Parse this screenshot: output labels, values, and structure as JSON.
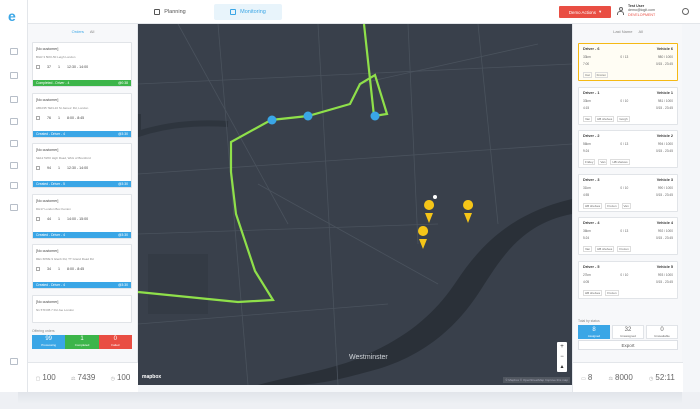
{
  "topbar": {
    "tabs": [
      {
        "label": "Planning"
      },
      {
        "label": "Monitoring"
      }
    ],
    "actions_label": "Demo Actions",
    "user": {
      "name": "Test User",
      "email": "demo@logit.com",
      "env": "DEVELOPMENT"
    }
  },
  "left": {
    "tabs": [
      "Orders",
      "All"
    ],
    "orders": [
      {
        "title": "[No customer]",
        "addr": "BGR 3 5RO-50 Leigh London",
        "qty": "37",
        "stops": "1",
        "time": "12:30 - 14:00",
        "status": "Completed - Driver - 4",
        "code": "@0:38",
        "color": "#3cb54a"
      },
      {
        "title": "[No customer]",
        "addr": "AB1035 7EFL10 St James' Rd, London",
        "qty": "76",
        "stops": "1",
        "time": "8:00 - 8:45",
        "status": "Created - Driver - 4",
        "code": "@3:30",
        "color": "#3aa6e6"
      },
      {
        "title": "[No customer]",
        "addr": "SE12 5WO High Road, Wick of Brentford",
        "qty": "94",
        "stops": "1",
        "time": "12:30 - 14:00",
        "status": "Created - Driver - 5",
        "code": "@3:30",
        "color": "#3aa6e6"
      },
      {
        "title": "[No customer]",
        "addr": "DH17 London Box Kenton",
        "qty": "44",
        "stops": "1",
        "time": "14:00 - 15:00",
        "status": "Created - Driver - 4",
        "code": "@3:30",
        "color": "#3aa6e6"
      },
      {
        "title": "[No customer]",
        "addr": "RE1 6PRE 9 Glenb Rd, TT Grand Road Rd",
        "qty": "34",
        "stops": "1",
        "time": "8:00 - 8:45",
        "status": "Created - Driver - 4",
        "code": "@3:30",
        "color": "#3aa6e6"
      },
      {
        "title": "[No customer]",
        "addr": "N1 5TFOB 7 Rd Joe London",
        "qty": "",
        "stops": "",
        "time": "",
        "status": "",
        "code": "",
        "color": "#3aa6e6"
      }
    ],
    "summary_label": "Offering orders",
    "summary": [
      {
        "value": "99",
        "label": "Processing",
        "color": "#3aa6e6"
      },
      {
        "value": "1",
        "label": "Completed",
        "color": "#3cb54a"
      },
      {
        "value": "0",
        "label": "Failed",
        "color": "#e94e43"
      }
    ],
    "stats": [
      "100",
      "7439",
      "100"
    ]
  },
  "map": {
    "labels": [
      {
        "text": "Westminster",
        "big": true
      },
      {
        "text": "mapbox",
        "big": false
      }
    ],
    "attribution": "© Mapbox © OpenStreetMap Improve this map",
    "zoom_in": "+",
    "zoom_out": "−"
  },
  "right": {
    "tabs": [
      "Last Name",
      "All"
    ],
    "vehicles": [
      {
        "driver": "Driver - 6",
        "vehicle": "Vehicle 6",
        "r1": [
          "33km",
          "0 / 13",
          "980 / 1000"
        ],
        "r2": [
          "7:00",
          "",
          "0/15 - 23:45"
        ],
        "tags": [
          "Cat",
          "Frozen"
        ],
        "selected": true
      },
      {
        "driver": "Driver - 1",
        "vehicle": "Vehicle 1",
        "r1": [
          "33km",
          "0 / 10",
          "981 / 1000"
        ],
        "r2": [
          "4:15",
          "",
          "0/15 - 23:45"
        ],
        "tags": [
          "Van",
          "HB shelves",
          "Gorgh"
        ],
        "selected": false
      },
      {
        "driver": "Driver - 2",
        "vehicle": "Vehicle 2",
        "r1": [
          "56km",
          "0 / 13",
          "994 / 1000"
        ],
        "r2": [
          "9:24",
          "",
          "0/15 - 23:45"
        ],
        "tags": [
          "Fridey",
          "Van",
          "HB shelves"
        ],
        "selected": false
      },
      {
        "driver": "Driver - 3",
        "vehicle": "Vehicle 3",
        "r1": [
          "31km",
          "0 / 10",
          "990 / 1000"
        ],
        "r2": [
          "4:55",
          "",
          "0/15 - 23:45"
        ],
        "tags": [
          "HB shelves",
          "Frozen",
          "Van"
        ],
        "selected": false
      },
      {
        "driver": "Driver - 4",
        "vehicle": "Vehicle 4",
        "r1": [
          "36km",
          "0 / 13",
          "992 / 1000"
        ],
        "r2": [
          "5:24",
          "",
          "0/15 - 23:45"
        ],
        "tags": [
          "Van",
          "HB shelves",
          "Frozen"
        ],
        "selected": false
      },
      {
        "driver": "Driver - 5",
        "vehicle": "Vehicle 5",
        "r1": [
          "27km",
          "0 / 10",
          "993 / 1000"
        ],
        "r2": [
          "4:05",
          "",
          "0/15 - 23:45"
        ],
        "tags": [
          "HB shelves",
          "Frozen"
        ],
        "selected": false
      }
    ],
    "summary_label": "Total by status",
    "summary": [
      {
        "value": "8",
        "label": "Assigned",
        "active": true
      },
      {
        "value": "32",
        "label": "Unassigned",
        "active": false
      },
      {
        "value": "0",
        "label": "Unavailable",
        "active": false
      }
    ],
    "export_label": "Export",
    "stats": [
      "8",
      "8000",
      "52:11"
    ]
  }
}
